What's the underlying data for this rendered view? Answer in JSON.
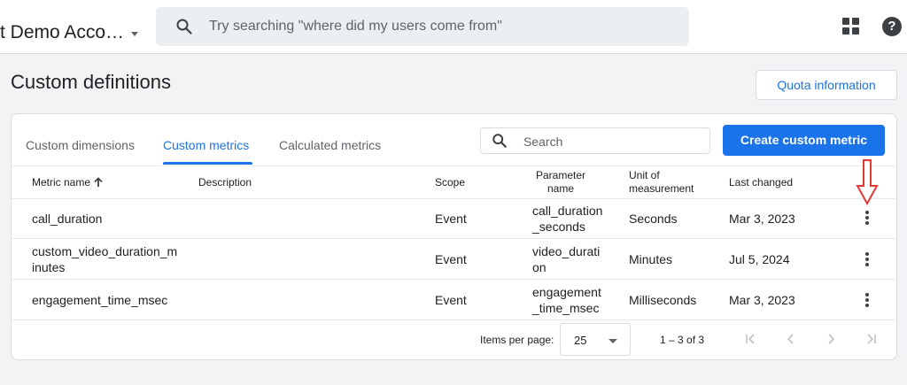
{
  "header": {
    "account": "t Demo Acco…",
    "search_placeholder": "Try searching \"where did my users come from\""
  },
  "page": {
    "title": "Custom definitions",
    "quota_button": "Quota information"
  },
  "tabs": [
    {
      "label": "Custom dimensions",
      "active": false
    },
    {
      "label": "Custom metrics",
      "active": true
    },
    {
      "label": "Calculated metrics",
      "active": false
    }
  ],
  "table_search_placeholder": "Search",
  "create_button": "Create custom metric",
  "columns": {
    "metric_name": "Metric name",
    "description": "Description",
    "scope": "Scope",
    "parameter_name": [
      "Parameter",
      "name"
    ],
    "unit": [
      "Unit of",
      "measurement"
    ],
    "last_changed": "Last changed"
  },
  "rows": [
    {
      "name": [
        "call_duration"
      ],
      "description": "",
      "scope": "Event",
      "parameter": [
        "call_duration",
        "_seconds"
      ],
      "unit": "Seconds",
      "last_changed": "Mar 3, 2023"
    },
    {
      "name": [
        "custom_video_duration_m",
        "inutes"
      ],
      "description": "",
      "scope": "Event",
      "parameter": [
        "video_durati",
        "on"
      ],
      "unit": "Minutes",
      "last_changed": "Jul 5, 2024"
    },
    {
      "name": [
        "engagement_time_msec"
      ],
      "description": "",
      "scope": "Event",
      "parameter": [
        "engagement",
        "_time_msec"
      ],
      "unit": "Milliseconds",
      "last_changed": "Mar 3, 2023"
    }
  ],
  "pagination": {
    "items_per_page_label": "Items per page:",
    "items_per_page": "25",
    "range": "1 – 3 of 3"
  },
  "colors": {
    "accent": "#1a73e8",
    "annotation_arrow": "#e53935"
  },
  "icons": [
    "search-icon",
    "caret-down-icon",
    "apps-grid-icon",
    "help-icon",
    "sort-up-arrow-icon",
    "more-vert-icon",
    "red-down-arrow-annotation",
    "first-page-icon",
    "previous-page-icon",
    "next-page-icon",
    "last-page-icon"
  ]
}
